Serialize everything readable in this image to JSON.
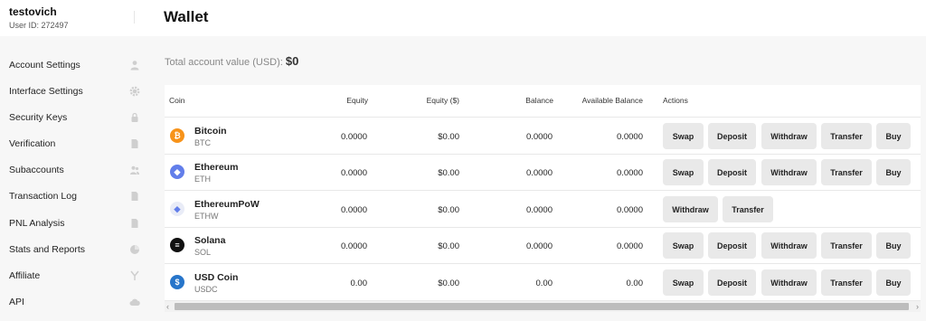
{
  "user": {
    "name": "testovich",
    "id_text": "User ID: 272497"
  },
  "page_title": "Wallet",
  "sidebar": {
    "items": [
      {
        "label": "Account Settings",
        "icon": "user-icon"
      },
      {
        "label": "Interface Settings",
        "icon": "gear-icon"
      },
      {
        "label": "Security Keys",
        "icon": "lock-icon"
      },
      {
        "label": "Verification",
        "icon": "document-icon"
      },
      {
        "label": "Subaccounts",
        "icon": "users-icon"
      },
      {
        "label": "Transaction Log",
        "icon": "document-icon"
      },
      {
        "label": "PNL Analysis",
        "icon": "document-icon"
      },
      {
        "label": "Stats and Reports",
        "icon": "pie-chart-icon"
      },
      {
        "label": "Affiliate",
        "icon": "fork-icon"
      },
      {
        "label": "API",
        "icon": "cloud-icon"
      }
    ]
  },
  "total": {
    "label": "Total account value (USD):",
    "value": "$0"
  },
  "table": {
    "headers": {
      "coin": "Coin",
      "equity": "Equity",
      "equity_usd": "Equity ($)",
      "balance": "Balance",
      "available": "Available Balance",
      "actions": "Actions"
    },
    "rows": [
      {
        "name": "Bitcoin",
        "symbol": "BTC",
        "icon": "bitcoin-icon",
        "color": "#f7931a",
        "equity": "0.0000",
        "equity_usd": "$0.00",
        "balance": "0.0000",
        "available": "0.0000"
      },
      {
        "name": "Ethereum",
        "symbol": "ETH",
        "icon": "ethereum-icon",
        "color": "#627eea",
        "equity": "0.0000",
        "equity_usd": "$0.00",
        "balance": "0.0000",
        "available": "0.0000"
      },
      {
        "name": "EthereumPoW",
        "symbol": "ETHW",
        "icon": "ethereumpow-icon",
        "color": "#e9ecf7",
        "equity": "0.0000",
        "equity_usd": "$0.00",
        "balance": "0.0000",
        "available": "0.0000"
      },
      {
        "name": "Solana",
        "symbol": "SOL",
        "icon": "solana-icon",
        "color": "#111111",
        "equity": "0.0000",
        "equity_usd": "$0.00",
        "balance": "0.0000",
        "available": "0.0000"
      },
      {
        "name": "USD Coin",
        "symbol": "USDC",
        "icon": "usdc-icon",
        "color": "#2775ca",
        "equity": "0.00",
        "equity_usd": "$0.00",
        "balance": "0.00",
        "available": "0.00"
      }
    ],
    "actions": {
      "swap": "Swap",
      "deposit": "Deposit",
      "withdraw": "Withdraw",
      "transfer": "Transfer",
      "buy": "Buy"
    }
  },
  "scrollbar": {
    "left_arrow": "‹",
    "right_arrow": "›"
  }
}
